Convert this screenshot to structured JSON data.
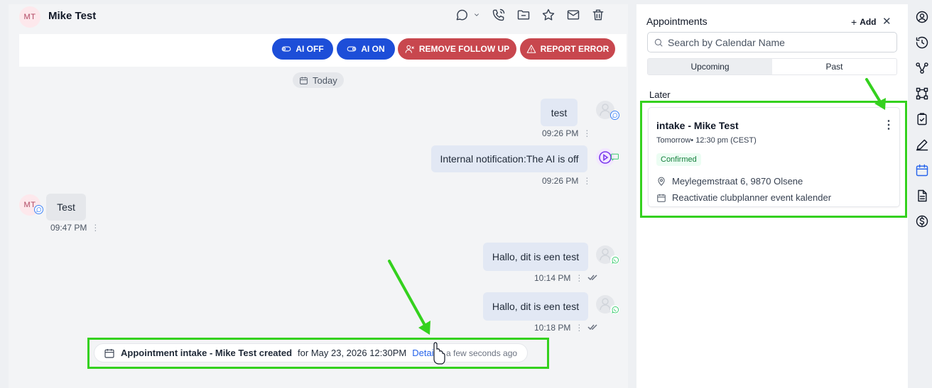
{
  "conversation": {
    "contact_initials": "MT",
    "contact_name": "Mike Test",
    "header_icons": [
      "chat-dropdown-icon",
      "phone-icon",
      "folder-icon",
      "star-icon",
      "mail-icon",
      "trash-icon"
    ],
    "actions": {
      "ai_off": "AI OFF",
      "ai_on": "AI ON",
      "remove_follow_up": "REMOVE FOLLOW UP",
      "report_error": "REPORT ERROR"
    },
    "day_label": "Today",
    "messages": [
      {
        "text": "test",
        "time": "09:26 PM",
        "direction": "outbound",
        "channel": "chat"
      },
      {
        "text": "Internal notification:The AI is off",
        "time": "09:26 PM",
        "direction": "outbound",
        "channel": "internal"
      },
      {
        "text": "Test",
        "time": "09:47 PM",
        "direction": "inbound",
        "channel": "chat",
        "sender_initials": "MT"
      },
      {
        "text": "Hallo, dit is een test",
        "time": "10:14 PM",
        "direction": "outbound",
        "channel": "whatsapp"
      },
      {
        "text": "Hallo, dit is een test",
        "time": "10:18 PM",
        "direction": "outbound",
        "channel": "whatsapp"
      }
    ],
    "event": {
      "strong": "Appointment intake - Mike Test created",
      "rest": "for May 23, 2026 12:30PM",
      "details_link": "Details",
      "time_ago": "a few seconds ago"
    }
  },
  "appointments_panel": {
    "title": "Appointments",
    "add_label": "Add",
    "close_glyph": "✕",
    "search_placeholder": "Search by Calendar Name",
    "tabs": [
      "Upcoming",
      "Past"
    ],
    "active_tab": "Upcoming",
    "section_label": "Later",
    "card": {
      "title": "intake - Mike Test",
      "when": "Tomorrow• 12:30 pm (CEST)",
      "status": "Confirmed",
      "location": "Meylegemstraat 6, 9870 Olsene",
      "calendar": "Reactivatie clubplanner event kalender"
    }
  },
  "right_rail": {
    "icons": [
      "contact-icon",
      "history-icon",
      "workflow-icon",
      "opportunities-icon",
      "tasks-icon",
      "notes-icon",
      "calendar-icon",
      "documents-icon",
      "payments-icon"
    ],
    "active": "calendar-icon"
  },
  "colors": {
    "primary_blue": "#1d4ed8",
    "danger_red": "#c8474e",
    "highlight_green": "#34d11e",
    "confirmed_green": "#15803d"
  }
}
